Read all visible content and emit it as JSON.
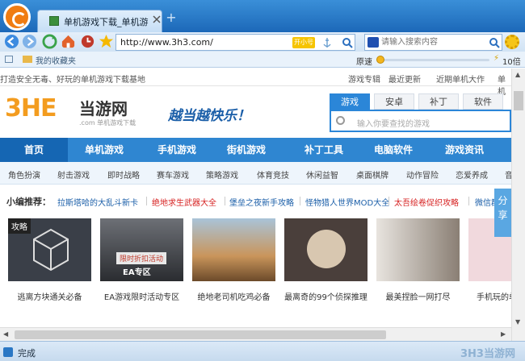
{
  "browser": {
    "tab_title": "单机游戏下载_单机游",
    "address": "http://www.3h3.com/",
    "address_badge": "开小号",
    "search_placeholder": "请输入搜索内容",
    "favorites": "我的收藏夹",
    "speed_label": "原速",
    "zoom_label": "10倍",
    "status": "完成",
    "watermark": "3H3当游网",
    "accent": "#2f86d1"
  },
  "site": {
    "top_slogan": "打造安全无毒、好玩的单机游戏下载基地",
    "top_links": [
      "游戏专辑",
      "最近更新",
      "近期单机大作",
      "单机"
    ],
    "logo_mark": "3HE",
    "logo_cn": "当游网",
    "logo_sub": ".com 单机游戏下载",
    "slogan": "越当越快乐！",
    "search_tabs": [
      "游戏",
      "安卓",
      "补丁",
      "软件"
    ],
    "search_placeholder": "输入你要查找的游戏",
    "nav": [
      "首页",
      "单机游戏",
      "手机游戏",
      "街机游戏",
      "补丁工具",
      "电脑软件",
      "游戏资讯"
    ],
    "subnav": [
      "角色扮演",
      "射击游戏",
      "即时战略",
      "赛车游戏",
      "策略游戏",
      "体育竞技",
      "休闲益智",
      "桌面棋牌",
      "动作冒险",
      "恋爱养成",
      "音"
    ],
    "editor_label": "小编推荐：",
    "picks": [
      {
        "text": "拉斯塔哈的大乱斗新卡",
        "color": "#1a5ea8"
      },
      {
        "text": "绝地求生武器大全",
        "color": "#d62020"
      },
      {
        "text": "堡垒之夜新手攻略",
        "color": "#1a5ea8"
      },
      {
        "text": "怪物猎人世界MOD大全",
        "color": "#1a5ea8"
      },
      {
        "text": "太吾绘卷促织攻略",
        "color": "#d62020"
      },
      {
        "text": "微信群",
        "color": "#1a5ea8"
      }
    ],
    "games": [
      {
        "caption": "逃离方块通关必备",
        "badge": "攻略"
      },
      {
        "caption": "EA游戏限时活动专区",
        "badge": "限时折扣活动",
        "sub": "EA专区"
      },
      {
        "caption": "绝地老司机吃鸡必备"
      },
      {
        "caption": "最离奇的99个侦探推理"
      },
      {
        "caption": "最美捏脸一网打尽"
      },
      {
        "caption": "手机玩的单"
      }
    ],
    "share": "分享"
  }
}
